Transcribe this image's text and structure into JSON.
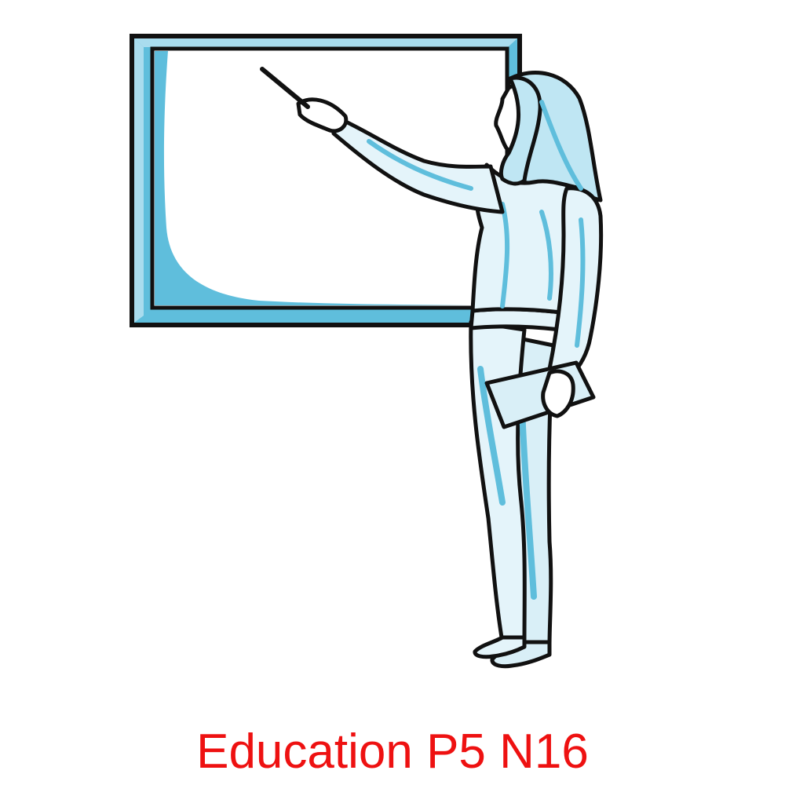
{
  "caption": {
    "text": "Education P5 N16",
    "color": "#ee1111"
  },
  "illustration": {
    "subject": "presenter-at-whiteboard",
    "colors": {
      "outline": "#111111",
      "accent": "#5fbedc",
      "light": "#e4f4fa",
      "background": "#ffffff"
    }
  }
}
